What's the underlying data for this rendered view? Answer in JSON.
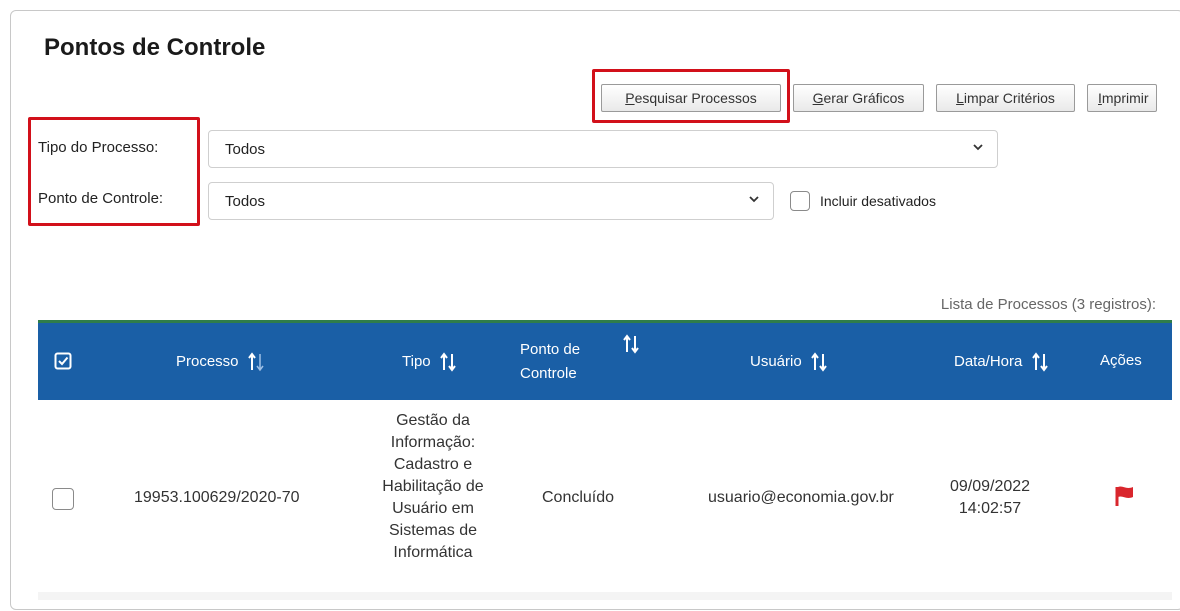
{
  "page": {
    "title": "Pontos de Controle"
  },
  "toolbar": {
    "search": {
      "accel": "P",
      "rest": "esquisar Processos"
    },
    "charts": {
      "accel": "G",
      "rest": "erar Gráficos"
    },
    "clear": {
      "accel": "L",
      "rest": "impar Critérios"
    },
    "print": {
      "accel": "I",
      "rest": "mprimir"
    }
  },
  "filters": {
    "tipo_processo": {
      "label": "Tipo do Processo:",
      "value": "Todos"
    },
    "ponto_controle": {
      "label": "Ponto de Controle:",
      "value": "Todos"
    },
    "incluir_desativados": {
      "label": "Incluir desativados",
      "checked": false
    }
  },
  "list": {
    "caption": "Lista de Processos (3 registros):",
    "headers": {
      "processo": "Processo",
      "tipo": "Tipo",
      "ponto_line1": "Ponto de",
      "ponto_line2": "Controle",
      "usuario": "Usuário",
      "data_hora": "Data/Hora",
      "acoes": "Ações"
    },
    "rows": [
      {
        "processo": "19953.100629/2020-70",
        "tipo_lines": [
          "Gestão da",
          "Informação:",
          "Cadastro e",
          "Habilitação de",
          "Usuário em",
          "Sistemas de",
          "Informática"
        ],
        "ponto": "Concluído",
        "usuario": "usuario@economia.gov.br",
        "data": "09/09/2022",
        "hora": "14:02:57"
      }
    ]
  },
  "icons": {
    "select_all": "checkbox-checked-icon",
    "sort": "sort-arrows-icon",
    "dropdown": "chevron-down-icon",
    "row_action": "flag-icon"
  },
  "colors": {
    "header_bg": "#1a5fa6",
    "header_top_line": "#2f7d4a",
    "highlight": "#d2101a",
    "flag": "#d9262d"
  }
}
